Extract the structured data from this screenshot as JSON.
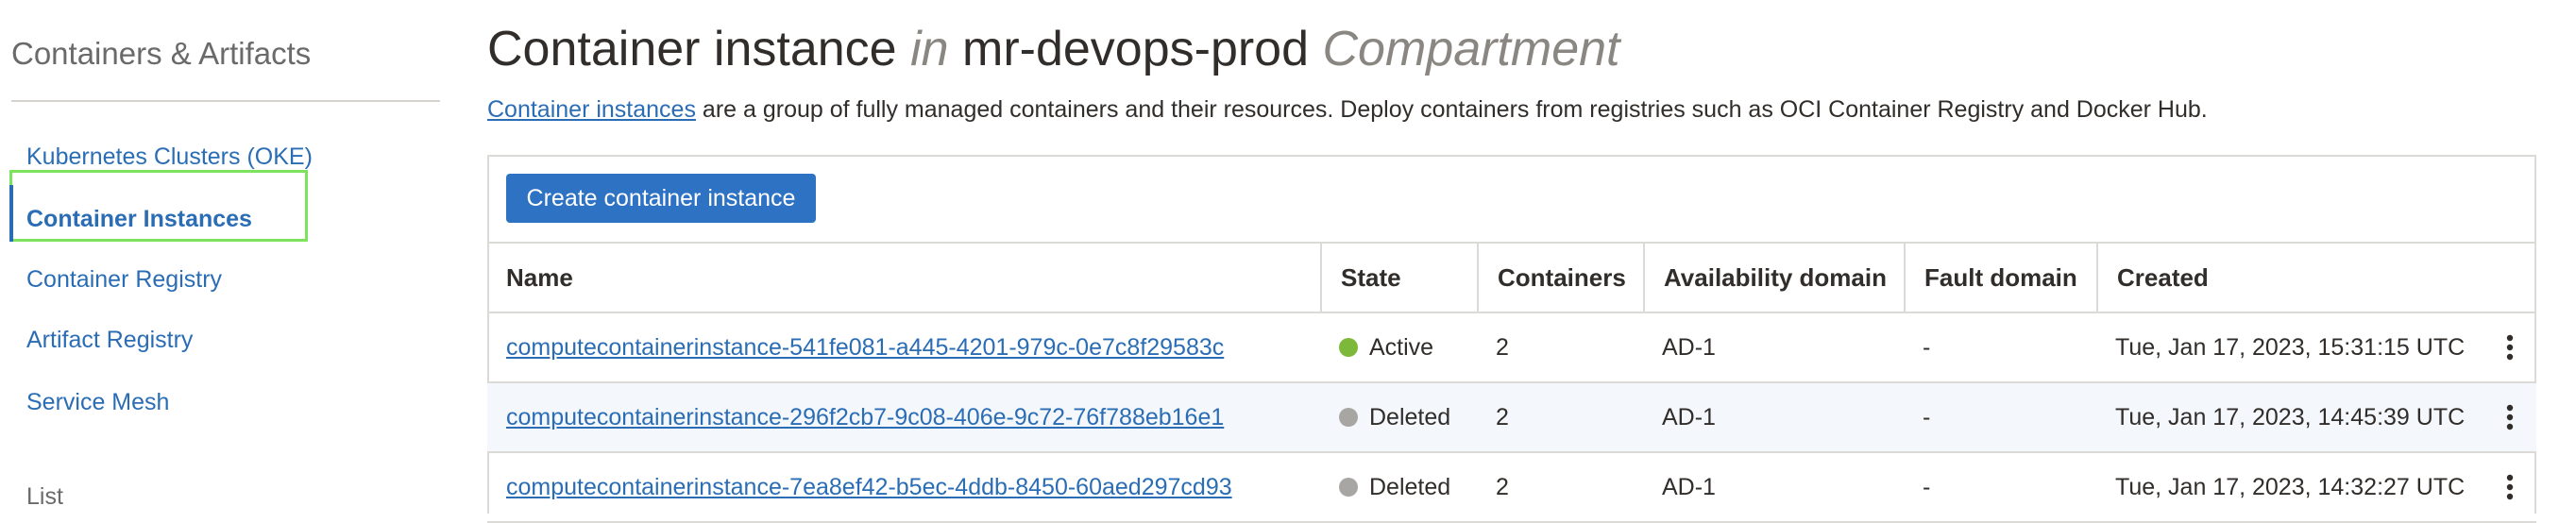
{
  "sidebar": {
    "title": "Containers & Artifacts",
    "items": [
      {
        "label": "Kubernetes Clusters (OKE)"
      },
      {
        "label": "Container Instances"
      },
      {
        "label": "Container Registry"
      },
      {
        "label": "Artifact Registry"
      },
      {
        "label": "Service Mesh"
      }
    ],
    "cut_off_label": "List"
  },
  "header": {
    "title_main": "Container instance",
    "title_in": "in",
    "title_compartment": "mr-devops-prod",
    "title_suffix": "Compartment"
  },
  "intro": {
    "link_text": "Container instances",
    "text": " are a group of fully managed containers and their resources. Deploy containers from registries such as OCI Container Registry and Docker Hub."
  },
  "toolbar": {
    "create_label": "Create container instance"
  },
  "table": {
    "columns": [
      "Name",
      "State",
      "Containers",
      "Availability domain",
      "Fault domain",
      "Created"
    ],
    "rows": [
      {
        "name": "computecontainerinstance-541fe081-a445-4201-979c-0e7c8f29583c",
        "state": "Active",
        "state_color": "#7cb83a",
        "containers": "2",
        "ad": "AD-1",
        "fd": "-",
        "created": "Tue, Jan 17, 2023, 15:31:15 UTC"
      },
      {
        "name": "computecontainerinstance-296f2cb7-9c08-406e-9c72-76f788eb16e1",
        "state": "Deleted",
        "state_color": "#a8a6a3",
        "containers": "2",
        "ad": "AD-1",
        "fd": "-",
        "created": "Tue, Jan 17, 2023, 14:45:39 UTC"
      },
      {
        "name": "computecontainerinstance-7ea8ef42-b5ec-4ddb-8450-60aed297cd93",
        "state": "Deleted",
        "state_color": "#a8a6a3",
        "containers": "2",
        "ad": "AD-1",
        "fd": "-",
        "created": "Tue, Jan 17, 2023, 14:32:27 UTC"
      }
    ]
  },
  "icons": {
    "row_actions": "more-vertical-icon"
  }
}
